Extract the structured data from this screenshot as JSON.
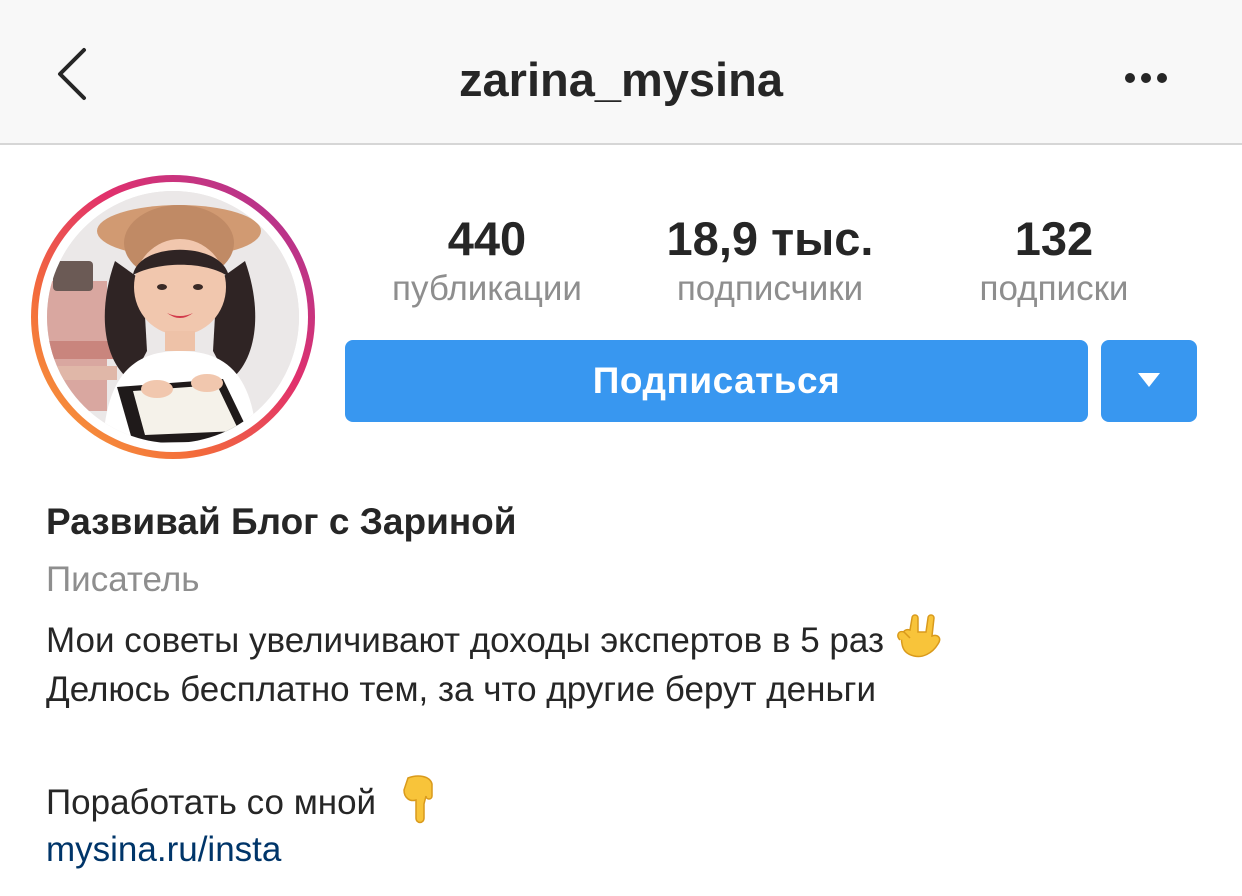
{
  "header": {
    "username": "zarina_mysina",
    "back_icon": "chevron-left-icon",
    "more_icon": "more-horizontal-icon"
  },
  "profile": {
    "avatar": "profile-photo",
    "story_ring_colors": [
      "#f8a83b",
      "#e1306c",
      "#a52c9a"
    ]
  },
  "stats": [
    {
      "value": "440",
      "label": "публикации"
    },
    {
      "value": "18,9 тыс.",
      "label": "подписчики"
    },
    {
      "value": "132",
      "label": "подписки"
    }
  ],
  "actions": {
    "follow_label": "Подписаться",
    "dropdown_icon": "triangle-down-icon",
    "accent_color": "#3897f0"
  },
  "bio": {
    "name": "Развивай Блог с Зариной",
    "category": "Писатель",
    "line1": "Мои советы увеличивают доходы экспертов в 5 раз",
    "line1_emoji": "rock-on-hand-emoji",
    "line2": "Делюсь бесплатно тем, за что другие берут деньги",
    "line3": "Поработать со мной",
    "line3_emoji": "pointing-down-hand-emoji",
    "link": "mysina.ru/insta",
    "link_color": "#003569"
  }
}
